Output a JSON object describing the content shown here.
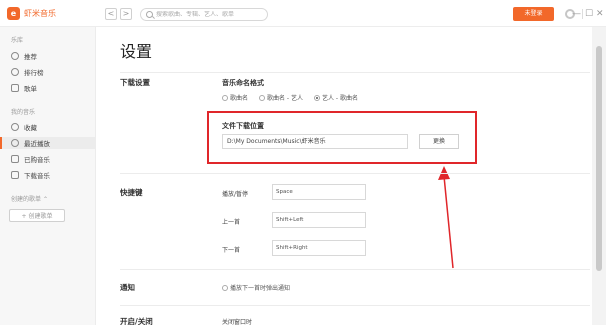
{
  "app": {
    "logo_text": "虾米音乐",
    "logo_glyph": "e"
  },
  "header": {
    "search_placeholder": "搜索歌曲、专辑、艺人、歌单",
    "login_label": "未登录",
    "back_glyph": "<",
    "forward_glyph": ">",
    "min_glyph": "—",
    "max_glyph": "☐",
    "close_glyph": "✕"
  },
  "sidebar": {
    "music_section": "乐库",
    "items_top": [
      "推荐",
      "排行榜",
      "歌单"
    ],
    "my_section": "我的音乐",
    "items_my": [
      "收藏",
      "最近播放",
      "已购音乐",
      "下载音乐"
    ],
    "created_section": "创建的歌单",
    "create_button": "+ 创建歌单",
    "active_item": "最近播放"
  },
  "settings": {
    "title": "设置",
    "download": {
      "section": "下载设置",
      "naming_title": "音乐命名格式",
      "naming_options": [
        "歌曲名",
        "歌曲名 - 艺人",
        "艺人 - 歌曲名"
      ],
      "naming_selected": 2,
      "location_title": "文件下载位置",
      "location_path": "D:\\My Documents\\Music\\虾米音乐",
      "change_button": "更换"
    },
    "hotkeys": {
      "section": "快捷键",
      "rows": [
        {
          "label": "播放/暂停",
          "value": "Space"
        },
        {
          "label": "上一首",
          "value": "Shift+Left"
        },
        {
          "label": "下一首",
          "value": "Shift+Right"
        }
      ]
    },
    "notify": {
      "section": "通知",
      "option": "播放下一首时弹出通知"
    },
    "close": {
      "section": "开启/关闭",
      "option": "关闭窗口时"
    }
  },
  "colors": {
    "accent": "#f2682a",
    "highlight_box": "#e0262a",
    "arrow": "#e0262a"
  }
}
